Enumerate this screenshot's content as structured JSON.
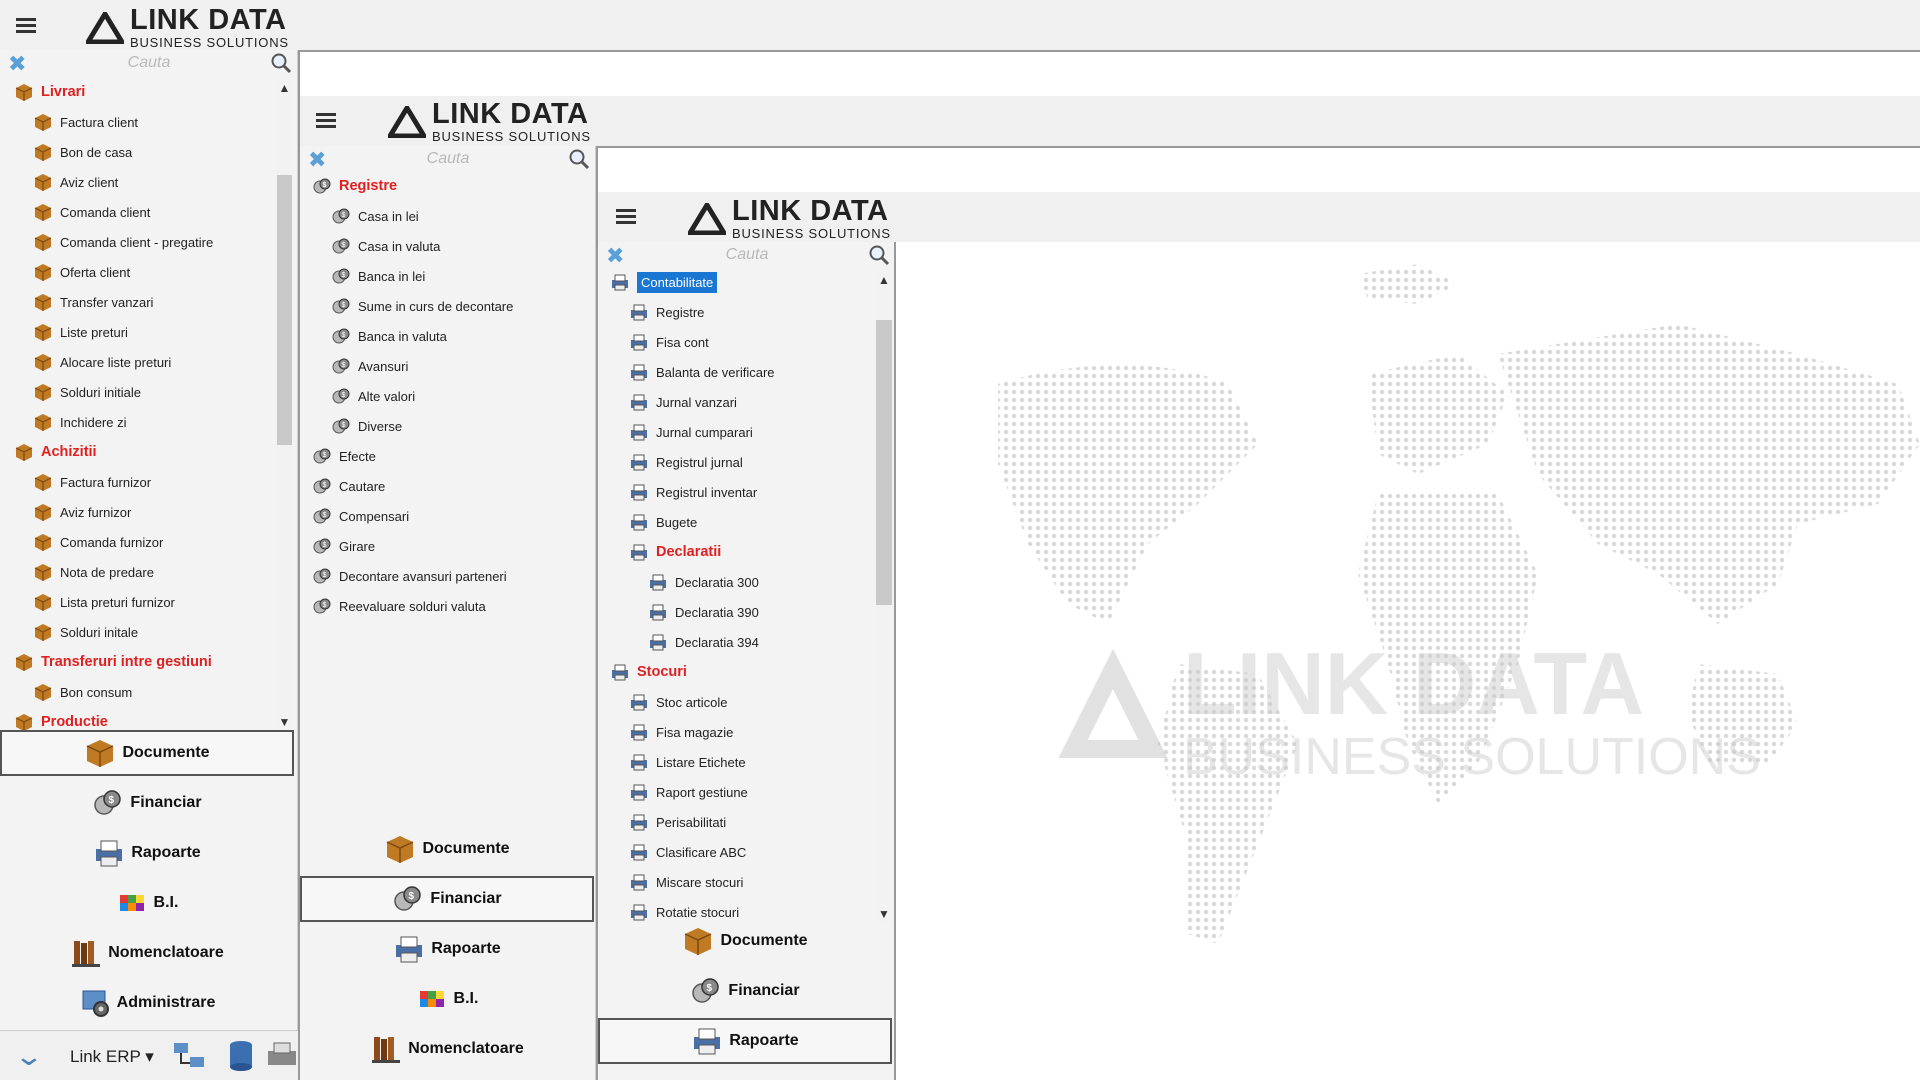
{
  "brand": {
    "name": "LINK DATA",
    "tagline": "BUSINESS SOLUTIONS"
  },
  "search": {
    "placeholder": "Cauta"
  },
  "panel1": {
    "tree": [
      {
        "label": "Livrari",
        "group": true
      },
      {
        "label": "Factura client"
      },
      {
        "label": "Bon de casa"
      },
      {
        "label": "Aviz client"
      },
      {
        "label": "Comanda client"
      },
      {
        "label": "Comanda client - pregatire"
      },
      {
        "label": "Oferta client"
      },
      {
        "label": "Transfer vanzari"
      },
      {
        "label": "Liste preturi"
      },
      {
        "label": "Alocare liste preturi"
      },
      {
        "label": "Solduri initiale"
      },
      {
        "label": "Inchidere zi"
      },
      {
        "label": "Achizitii",
        "group": true
      },
      {
        "label": "Factura furnizor"
      },
      {
        "label": "Aviz furnizor"
      },
      {
        "label": "Comanda furnizor"
      },
      {
        "label": "Nota de predare"
      },
      {
        "label": "Lista preturi furnizor"
      },
      {
        "label": "Solduri initale"
      },
      {
        "label": "Transferuri intre gestiuni",
        "group": true
      },
      {
        "label": "Bon consum"
      },
      {
        "label": "Productie",
        "group": true
      }
    ],
    "nav": [
      "Documente",
      "Financiar",
      "Rapoarte",
      "B.I.",
      "Nomenclatoare",
      "Administrare"
    ],
    "bottom": {
      "app": "Link ERP",
      "dropdown_arrow": "▾"
    }
  },
  "panel2": {
    "tree": [
      {
        "label": "Registre",
        "group": true
      },
      {
        "label": "Casa in lei"
      },
      {
        "label": "Casa in valuta"
      },
      {
        "label": "Banca in lei"
      },
      {
        "label": "Sume in curs de decontare"
      },
      {
        "label": "Banca in valuta"
      },
      {
        "label": "Avansuri"
      },
      {
        "label": "Alte valori"
      },
      {
        "label": "Diverse"
      },
      {
        "label": "Efecte",
        "top": true
      },
      {
        "label": "Cautare",
        "top": true
      },
      {
        "label": "Compensari",
        "top": true
      },
      {
        "label": "Girare",
        "top": true
      },
      {
        "label": "Decontare avansuri parteneri",
        "top": true
      },
      {
        "label": "Reevaluare solduri valuta",
        "top": true
      }
    ],
    "nav": [
      "Documente",
      "Financiar",
      "Rapoarte",
      "B.I.",
      "Nomenclatoare"
    ]
  },
  "panel3": {
    "tree": [
      {
        "label": "Contabilitate",
        "selected": true
      },
      {
        "label": "Registre"
      },
      {
        "label": "Fisa cont"
      },
      {
        "label": "Balanta de verificare"
      },
      {
        "label": "Jurnal vanzari"
      },
      {
        "label": "Jurnal cumparari"
      },
      {
        "label": "Registrul jurnal"
      },
      {
        "label": "Registrul inventar"
      },
      {
        "label": "Bugete"
      },
      {
        "label": "Declaratii",
        "group": true,
        "sub": true
      },
      {
        "label": "Declaratia 300",
        "deep": true
      },
      {
        "label": "Declaratia 390",
        "deep": true
      },
      {
        "label": "Declaratia 394",
        "deep": true
      },
      {
        "label": "Stocuri",
        "group": true
      },
      {
        "label": "Stoc articole"
      },
      {
        "label": "Fisa magazie"
      },
      {
        "label": "Listare Etichete"
      },
      {
        "label": "Raport gestiune"
      },
      {
        "label": "Perisabilitati"
      },
      {
        "label": "Clasificare ABC"
      },
      {
        "label": "Miscare stocuri"
      },
      {
        "label": "Rotatie stocuri"
      }
    ],
    "nav": [
      "Documente",
      "Financiar",
      "Rapoarte"
    ]
  },
  "colors": {
    "group": "#e02020",
    "selected": "#1976d2",
    "accent": "#5a9fd6"
  },
  "icons": {
    "documente": "box-icon",
    "financiar": "money-icon",
    "rapoarte": "printer-icon",
    "bi": "cube-icon",
    "nomenclatoare": "books-icon",
    "administrare": "admin-icon"
  }
}
